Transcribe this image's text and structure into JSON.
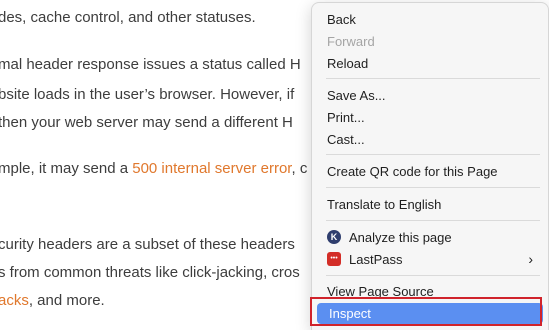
{
  "article": {
    "lines": [
      {
        "text": "des, cache control, and other statuses."
      },
      {
        "text": "mal header response issues a status called H"
      },
      {
        "text": "bsite loads in the user’s browser. However, if"
      },
      {
        "text": " then your web server may send a different H"
      },
      {
        "pre": "mple, it may send a ",
        "link": "500 internal server error",
        "post": ", c"
      },
      {
        "text": "curity headers are a subset of these headers"
      },
      {
        "text": "s from common threats like click-jacking, cros"
      },
      {
        "link": "acks",
        "post": ", and more."
      }
    ]
  },
  "context_menu": {
    "items": {
      "back": "Back",
      "forward": "Forward",
      "reload": "Reload",
      "save_as": "Save As...",
      "print": "Print...",
      "cast": "Cast...",
      "qr_code": "Create QR code for this Page",
      "translate": "Translate to English",
      "analyze": "Analyze this page",
      "lastpass": "LastPass",
      "view_source": "View Page Source",
      "inspect": "Inspect"
    },
    "submenu_chevron": "›",
    "disabled": [
      "forward"
    ],
    "highlighted": "inspect",
    "highlight_color": "#5b8ff1",
    "outline_color": "#d0232b"
  }
}
